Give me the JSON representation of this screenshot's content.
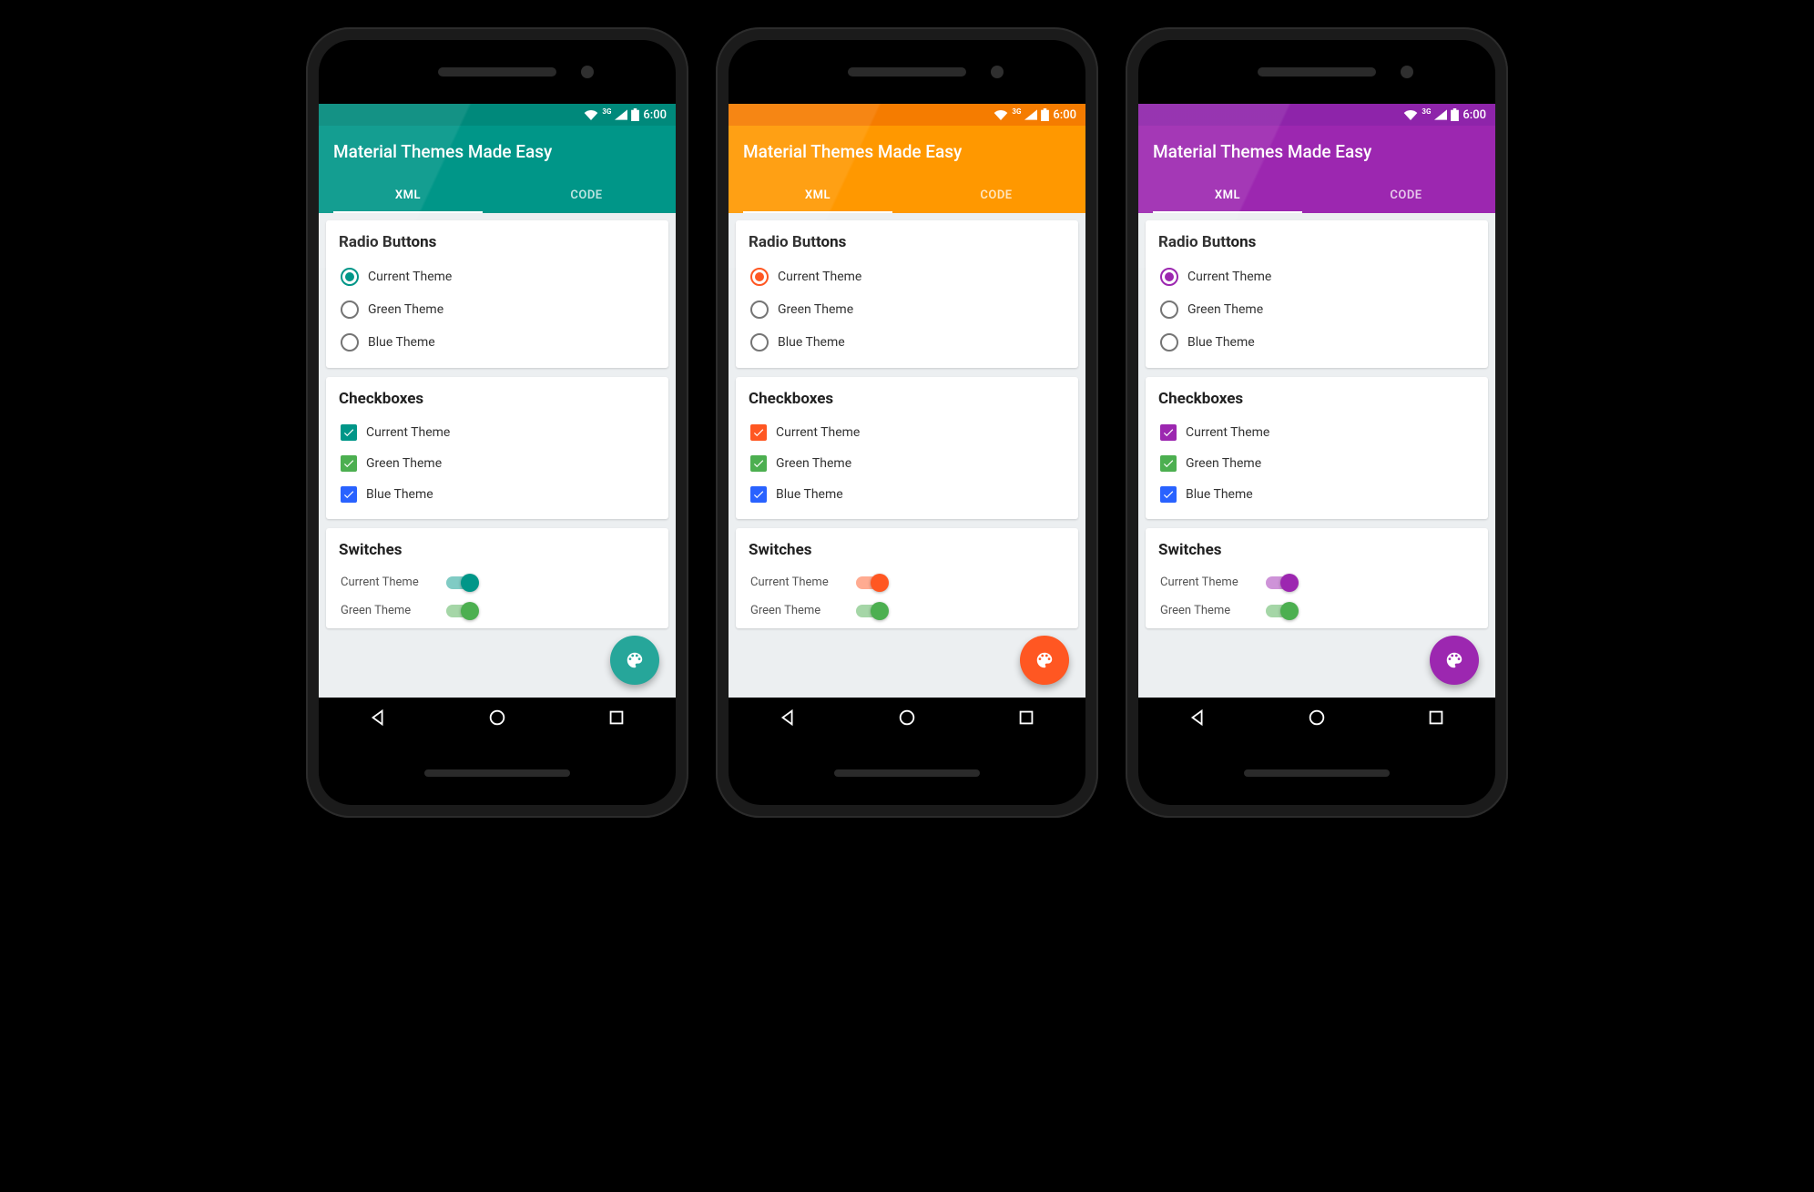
{
  "status": {
    "time": "6:00",
    "net": "3G"
  },
  "toolbar": {
    "title": "Material Themes Made Easy"
  },
  "tabs": {
    "xml": "XML",
    "code": "CODE"
  },
  "cards": {
    "radio": {
      "title": "Radio Buttons",
      "items": [
        "Current Theme",
        "Green Theme",
        "Blue Theme"
      ]
    },
    "checkbox": {
      "title": "Checkboxes",
      "items": [
        "Current Theme",
        "Green Theme",
        "Blue Theme"
      ]
    },
    "switches": {
      "title": "Switches",
      "items": [
        "Current Theme",
        "Green Theme"
      ]
    }
  },
  "themes": [
    {
      "id": "teal",
      "primary_dark": "#00897b",
      "primary": "#009688",
      "accent": "#009688",
      "accent_light": "#80cbc4",
      "fab": "#26a69a"
    },
    {
      "id": "orange",
      "primary_dark": "#f57c00",
      "primary": "#ff9800",
      "accent": "#ff5722",
      "accent_light": "#ffab91",
      "fab": "#ff5722"
    },
    {
      "id": "purple",
      "primary_dark": "#8e24aa",
      "primary": "#9c27b0",
      "accent": "#9c27b0",
      "accent_light": "#ce93d8",
      "fab": "#9c27b0"
    }
  ],
  "fixed_colors": {
    "green_checkbox": "#4caf50",
    "blue_checkbox": "#2962ff",
    "green_switch_thumb": "#4caf50",
    "green_switch_track": "#a5d6a7"
  }
}
